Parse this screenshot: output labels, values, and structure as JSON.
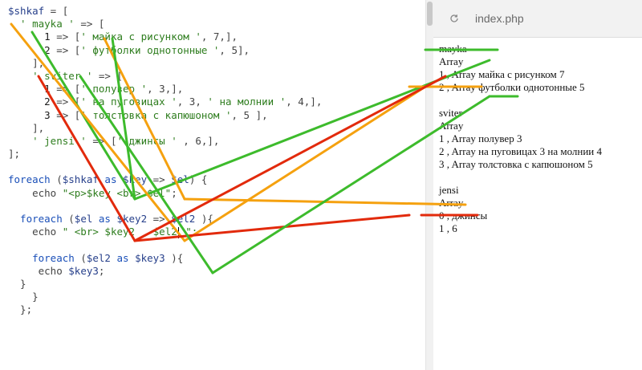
{
  "editor": {
    "lines": [
      [
        {
          "t": "$shkaf",
          "c": "var"
        },
        {
          "t": " = [",
          "c": "op"
        }
      ],
      [
        {
          "t": "  ' mayka '",
          "c": "str"
        },
        {
          "t": " => [",
          "c": "op"
        }
      ],
      [
        {
          "t": "      1",
          "c": "num"
        },
        {
          "t": " => [",
          "c": "op"
        },
        {
          "t": "' майка с рисунком '",
          "c": "str"
        },
        {
          "t": ", 7,],",
          "c": "op"
        }
      ],
      [
        {
          "t": "      2",
          "c": "num"
        },
        {
          "t": " => [",
          "c": "op"
        },
        {
          "t": "' футболки однотонные '",
          "c": "str"
        },
        {
          "t": ", 5],",
          "c": "op"
        }
      ],
      [
        {
          "t": "    ],",
          "c": "op"
        }
      ],
      [
        {
          "t": "    ' sviter '",
          "c": "str"
        },
        {
          "t": " => [",
          "c": "op"
        }
      ],
      [
        {
          "t": "      1",
          "c": "num"
        },
        {
          "t": " => [",
          "c": "op"
        },
        {
          "t": "' полувер '",
          "c": "str"
        },
        {
          "t": ", 3,],",
          "c": "op"
        }
      ],
      [
        {
          "t": "      2",
          "c": "num"
        },
        {
          "t": " => [",
          "c": "op"
        },
        {
          "t": "' на пуговицах '",
          "c": "str"
        },
        {
          "t": ", 3, ",
          "c": "op"
        },
        {
          "t": "' на молнии '",
          "c": "str"
        },
        {
          "t": ", 4,],",
          "c": "op"
        }
      ],
      [
        {
          "t": "      3",
          "c": "num"
        },
        {
          "t": " => [",
          "c": "op"
        },
        {
          "t": "' толстовка с капюшоном '",
          "c": "str"
        },
        {
          "t": ", 5 ],",
          "c": "op"
        }
      ],
      [
        {
          "t": "    ],",
          "c": "op"
        }
      ],
      [
        {
          "t": "    ' jensi '",
          "c": "str"
        },
        {
          "t": " => [",
          "c": "op"
        },
        {
          "t": "' джинсы '",
          "c": "str"
        },
        {
          "t": " , 6,],",
          "c": "op"
        }
      ],
      [
        {
          "t": "];",
          "c": "op"
        }
      ],
      [],
      [
        {
          "t": "foreach",
          "c": "kw"
        },
        {
          "t": " (",
          "c": "op"
        },
        {
          "t": "$shkaf",
          "c": "var"
        },
        {
          "t": " as ",
          "c": "kw"
        },
        {
          "t": "$key",
          "c": "var"
        },
        {
          "t": " => ",
          "c": "op"
        },
        {
          "t": "$el",
          "c": "var"
        },
        {
          "t": ") {",
          "c": "op"
        }
      ],
      [
        {
          "t": "    echo ",
          "c": "op"
        },
        {
          "t": "\"<p>$key <br> $el\"",
          "c": "str"
        },
        {
          "t": ";",
          "c": "op"
        }
      ],
      [],
      [
        {
          "t": "  foreach",
          "c": "kw"
        },
        {
          "t": " (",
          "c": "op"
        },
        {
          "t": "$el",
          "c": "var"
        },
        {
          "t": " as ",
          "c": "kw"
        },
        {
          "t": "$key2",
          "c": "var"
        },
        {
          "t": " => ",
          "c": "op"
        },
        {
          "t": "$el2",
          "c": "var"
        },
        {
          "t": " ){",
          "c": "op"
        }
      ],
      [
        {
          "t": "    echo ",
          "c": "op"
        },
        {
          "t": "\" <br> $key2   $el2",
          "c": "str"
        },
        {
          "t": "|caret|",
          "c": "caret"
        },
        {
          "t": " \";",
          "c": "str"
        }
      ],
      [],
      [
        {
          "t": "    foreach",
          "c": "kw"
        },
        {
          "t": " (",
          "c": "op"
        },
        {
          "t": "$el2",
          "c": "var"
        },
        {
          "t": " as ",
          "c": "kw"
        },
        {
          "t": "$key3",
          "c": "var"
        },
        {
          "t": " ){",
          "c": "op"
        }
      ],
      [
        {
          "t": "     echo ",
          "c": "op"
        },
        {
          "t": "$key3",
          "c": "var"
        },
        {
          "t": ";",
          "c": "op"
        }
      ],
      [
        {
          "t": "  }",
          "c": "op"
        }
      ],
      [
        {
          "t": "    }",
          "c": "op"
        }
      ],
      [
        {
          "t": "  };",
          "c": "op"
        }
      ]
    ]
  },
  "browser": {
    "tab_title": "index.php",
    "reload_icon": "reload-icon",
    "output": [
      "mayka",
      "Array",
      "1 , Array майка с рисунком 7",
      "2 , Array футболки однотонные 5",
      "",
      "sviter",
      "Array",
      "1 , Array полувер 3",
      "2 , Array на пуговицах 3 на молнии 4",
      "3 , Array толстовка с капюшоном 5",
      "",
      "jensi",
      "Array",
      "0 , джинсы",
      "1 , 6"
    ]
  },
  "annotations": {
    "colors": {
      "green": "#3dbb2c",
      "orange": "#f5a10f",
      "red": "#e22a0c"
    }
  }
}
